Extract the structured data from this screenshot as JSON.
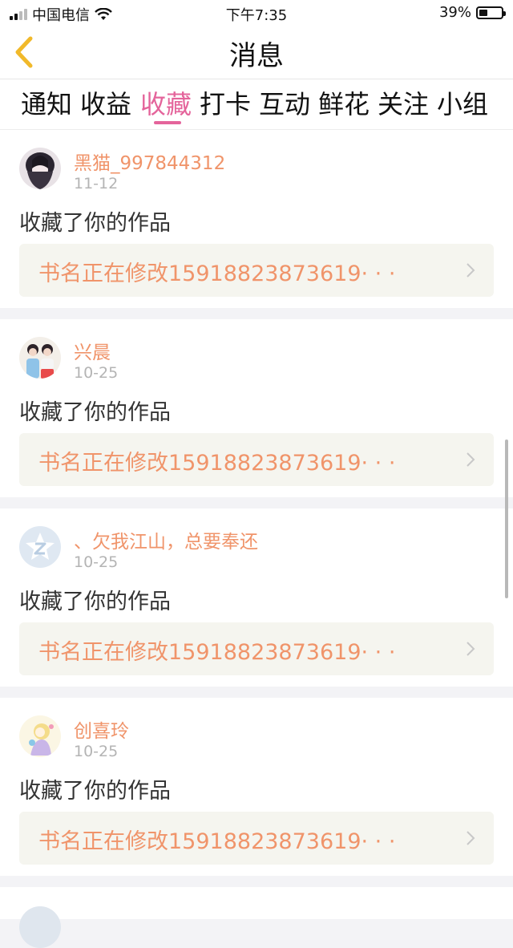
{
  "status_bar": {
    "carrier": "中国电信",
    "time": "下午7:35",
    "battery": "39%"
  },
  "header": {
    "title": "消息"
  },
  "tabs": [
    {
      "label": "通知",
      "active": false
    },
    {
      "label": "收益",
      "active": false
    },
    {
      "label": "收藏",
      "active": true
    },
    {
      "label": "打卡",
      "active": false
    },
    {
      "label": "互动",
      "active": false
    },
    {
      "label": "鲜花",
      "active": false
    },
    {
      "label": "关注",
      "active": false
    },
    {
      "label": "小组",
      "active": false
    }
  ],
  "colors": {
    "accent": "#e4649b",
    "username": "#f0946a",
    "link_bg": "#f5f5ef"
  },
  "notifications": [
    {
      "username": "黑猫_997844312",
      "date": "11-12",
      "action": "收藏了你的作品",
      "work_title": "书名正在修改15918823873619· · ·",
      "avatar": "dark-anime-avatar"
    },
    {
      "username": "兴晨",
      "date": "10-25",
      "action": "收藏了你的作品",
      "work_title": "书名正在修改15918823873619· · ·",
      "avatar": "two-girls-photo-avatar"
    },
    {
      "username": "、欠我江山，总要奉还",
      "date": "10-25",
      "action": "收藏了你的作品",
      "work_title": "书名正在修改15918823873619· · ·",
      "avatar": "default-qq-avatar"
    },
    {
      "username": "创喜玲",
      "date": "10-25",
      "action": "收藏了你的作品",
      "work_title": "书名正在修改15918823873619· · ·",
      "avatar": "cartoon-avatar"
    }
  ]
}
